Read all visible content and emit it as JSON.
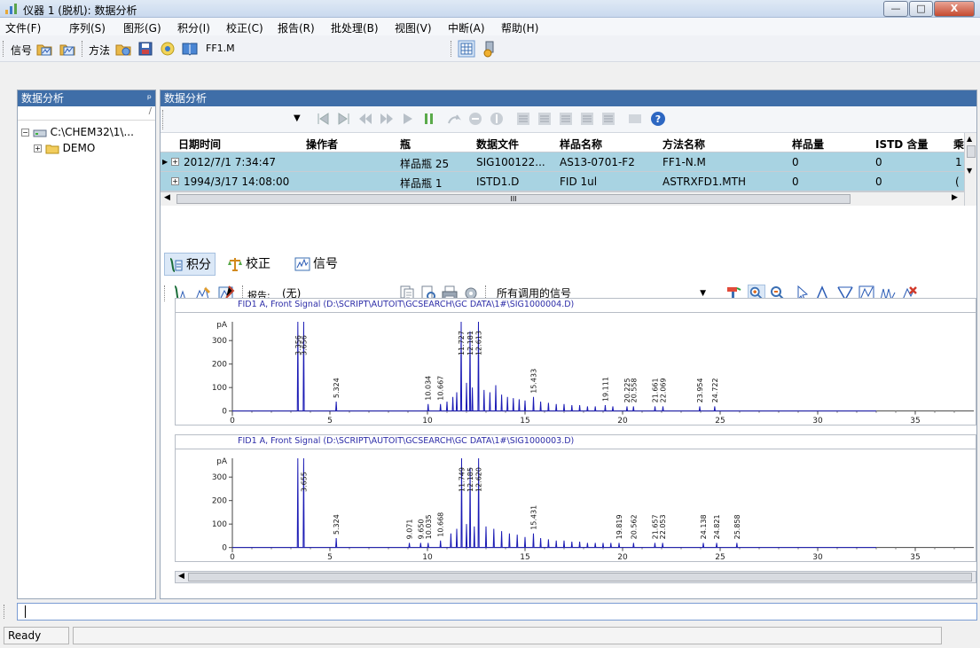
{
  "window": {
    "title": "仪器 1 (脱机): 数据分析",
    "icon": "bar-chart-icon",
    "buttons": {
      "minimize": "—",
      "maximize": "□",
      "close": "X"
    }
  },
  "menu": [
    "文件(F)",
    "序列(S)",
    "图形(G)",
    "积分(I)",
    "校正(C)",
    "报告(R)",
    "批处理(B)",
    "视图(V)",
    "中断(A)",
    "帮助(H)"
  ],
  "toolbar": {
    "signal_label": "信号",
    "method_label": "方法",
    "method_file": "FF1.M"
  },
  "left_panel": {
    "title": "数据分析",
    "pin": "ᵖ",
    "path_hint": "/",
    "tree": [
      {
        "label": "C:\\CHEM32\\1\\..."
      },
      {
        "label": "DEMO"
      }
    ]
  },
  "right_panel": {
    "title": "数据分析",
    "table": {
      "columns": [
        "日期时间",
        "操作者",
        "瓶",
        "数据文件",
        "样品名称",
        "方法名称",
        "样品量",
        "ISTD 含量",
        "乘"
      ],
      "rows": [
        [
          "2012/7/1 7:34:47",
          "",
          "样品瓶 25",
          "SIG100122...",
          "AS13-0701-F2",
          "FF1-N.M",
          "0",
          "0",
          "1"
        ],
        [
          "1994/3/17 14:08:00",
          "",
          "样品瓶 1",
          "ISTD1.D",
          "FID 1ul",
          "ASTRXFD1.MTH",
          "0",
          "0",
          "("
        ]
      ],
      "hscroll_glyph": "III"
    },
    "tabs": [
      {
        "label": "积分",
        "icon": "integration-icon"
      },
      {
        "label": "校正",
        "icon": "scale-icon"
      },
      {
        "label": "信号",
        "icon": "signal-icon"
      }
    ],
    "report_label": "报告:",
    "report_value": "(无)",
    "signal_select": "所有调用的信号"
  },
  "status": {
    "ready": "Ready"
  },
  "colors": {
    "signal": "#1b1bb5",
    "selected_row": "#a8d3e2",
    "header": "#3f6ea8"
  },
  "chart_data": [
    {
      "type": "line",
      "title": "FID1 A, Front Signal (D:\\SCRIPT\\AUTOIT\\GCSEARCH\\GC DATA\\1#\\SIG1000004.D)",
      "ylabel": "pA",
      "xlim": [
        0,
        38
      ],
      "ylim": [
        -5,
        380
      ],
      "xticks": [
        0,
        5,
        10,
        15,
        20,
        25,
        30,
        35
      ],
      "yticks": [
        0,
        100,
        200,
        300
      ],
      "peaks": [
        {
          "t": 3.356,
          "h": 380,
          "label": "3.356"
        },
        {
          "t": 3.656,
          "h": 380,
          "label": "3.656"
        },
        {
          "t": 5.324,
          "h": 40,
          "label": "5.324"
        },
        {
          "t": 10.034,
          "h": 30,
          "label": "10.034"
        },
        {
          "t": 10.667,
          "h": 30,
          "label": "10.667"
        },
        {
          "t": 11.0,
          "h": 40,
          "label": ""
        },
        {
          "t": 11.3,
          "h": 60,
          "label": ""
        },
        {
          "t": 11.5,
          "h": 80,
          "label": ""
        },
        {
          "t": 11.727,
          "h": 380,
          "label": "11.727"
        },
        {
          "t": 12.0,
          "h": 120,
          "label": ""
        },
        {
          "t": 12.181,
          "h": 340,
          "label": "12.181"
        },
        {
          "t": 12.3,
          "h": 100,
          "label": ""
        },
        {
          "t": 12.613,
          "h": 380,
          "label": "12.613"
        },
        {
          "t": 12.9,
          "h": 90,
          "label": ""
        },
        {
          "t": 13.2,
          "h": 80,
          "label": ""
        },
        {
          "t": 13.5,
          "h": 110,
          "label": ""
        },
        {
          "t": 13.8,
          "h": 70,
          "label": ""
        },
        {
          "t": 14.1,
          "h": 60,
          "label": ""
        },
        {
          "t": 14.4,
          "h": 55,
          "label": ""
        },
        {
          "t": 14.7,
          "h": 50,
          "label": ""
        },
        {
          "t": 15.0,
          "h": 45,
          "label": ""
        },
        {
          "t": 15.433,
          "h": 60,
          "label": "15.433"
        },
        {
          "t": 15.8,
          "h": 40,
          "label": ""
        },
        {
          "t": 16.2,
          "h": 35,
          "label": ""
        },
        {
          "t": 16.6,
          "h": 30,
          "label": ""
        },
        {
          "t": 17.0,
          "h": 30,
          "label": ""
        },
        {
          "t": 17.4,
          "h": 25,
          "label": ""
        },
        {
          "t": 17.8,
          "h": 25,
          "label": ""
        },
        {
          "t": 18.2,
          "h": 20,
          "label": ""
        },
        {
          "t": 18.6,
          "h": 20,
          "label": ""
        },
        {
          "t": 19.111,
          "h": 25,
          "label": "19.111"
        },
        {
          "t": 19.5,
          "h": 20,
          "label": ""
        },
        {
          "t": 20.225,
          "h": 20,
          "label": "20.225"
        },
        {
          "t": 20.558,
          "h": 20,
          "label": "20.558"
        },
        {
          "t": 21.661,
          "h": 20,
          "label": "21.661"
        },
        {
          "t": 22.069,
          "h": 20,
          "label": "22.069"
        },
        {
          "t": 23.954,
          "h": 20,
          "label": "23.954"
        },
        {
          "t": 24.722,
          "h": 20,
          "label": "24.722"
        }
      ]
    },
    {
      "type": "line",
      "title": "FID1 A, Front Signal (D:\\SCRIPT\\AUTOIT\\GCSEARCH\\GC DATA\\1#\\SIG1000003.D)",
      "ylabel": "pA",
      "xlim": [
        0,
        38
      ],
      "ylim": [
        -5,
        380
      ],
      "xticks": [
        0,
        5,
        10,
        15,
        20,
        25,
        30,
        35
      ],
      "yticks": [
        0,
        100,
        200,
        300
      ],
      "peaks": [
        {
          "t": 3.355,
          "h": 380,
          "label": ""
        },
        {
          "t": 3.655,
          "h": 380,
          "label": "3.655"
        },
        {
          "t": 5.324,
          "h": 40,
          "label": "5.324"
        },
        {
          "t": 9.071,
          "h": 20,
          "label": "9.071"
        },
        {
          "t": 9.65,
          "h": 20,
          "label": "9.650"
        },
        {
          "t": 10.035,
          "h": 20,
          "label": "10.035"
        },
        {
          "t": 10.668,
          "h": 30,
          "label": "10.668"
        },
        {
          "t": 11.2,
          "h": 60,
          "label": ""
        },
        {
          "t": 11.5,
          "h": 80,
          "label": ""
        },
        {
          "t": 11.749,
          "h": 380,
          "label": "11.749"
        },
        {
          "t": 12.0,
          "h": 100,
          "label": ""
        },
        {
          "t": 12.185,
          "h": 340,
          "label": "12.185"
        },
        {
          "t": 12.4,
          "h": 90,
          "label": ""
        },
        {
          "t": 12.62,
          "h": 380,
          "label": "12.620"
        },
        {
          "t": 13.0,
          "h": 90,
          "label": ""
        },
        {
          "t": 13.4,
          "h": 80,
          "label": ""
        },
        {
          "t": 13.8,
          "h": 70,
          "label": ""
        },
        {
          "t": 14.2,
          "h": 60,
          "label": ""
        },
        {
          "t": 14.6,
          "h": 55,
          "label": ""
        },
        {
          "t": 15.0,
          "h": 45,
          "label": ""
        },
        {
          "t": 15.431,
          "h": 60,
          "label": "15.431"
        },
        {
          "t": 15.8,
          "h": 40,
          "label": ""
        },
        {
          "t": 16.2,
          "h": 35,
          "label": ""
        },
        {
          "t": 16.6,
          "h": 30,
          "label": ""
        },
        {
          "t": 17.0,
          "h": 30,
          "label": ""
        },
        {
          "t": 17.4,
          "h": 25,
          "label": ""
        },
        {
          "t": 17.8,
          "h": 25,
          "label": ""
        },
        {
          "t": 18.2,
          "h": 20,
          "label": ""
        },
        {
          "t": 18.6,
          "h": 20,
          "label": ""
        },
        {
          "t": 19.0,
          "h": 20,
          "label": ""
        },
        {
          "t": 19.4,
          "h": 20,
          "label": ""
        },
        {
          "t": 19.819,
          "h": 20,
          "label": "19.819"
        },
        {
          "t": 20.562,
          "h": 20,
          "label": "20.562"
        },
        {
          "t": 21.657,
          "h": 20,
          "label": "21.657"
        },
        {
          "t": 22.053,
          "h": 20,
          "label": "22.053"
        },
        {
          "t": 24.138,
          "h": 20,
          "label": "24.138"
        },
        {
          "t": 24.821,
          "h": 20,
          "label": "24.821"
        },
        {
          "t": 25.858,
          "h": 20,
          "label": "25.858"
        }
      ]
    }
  ]
}
